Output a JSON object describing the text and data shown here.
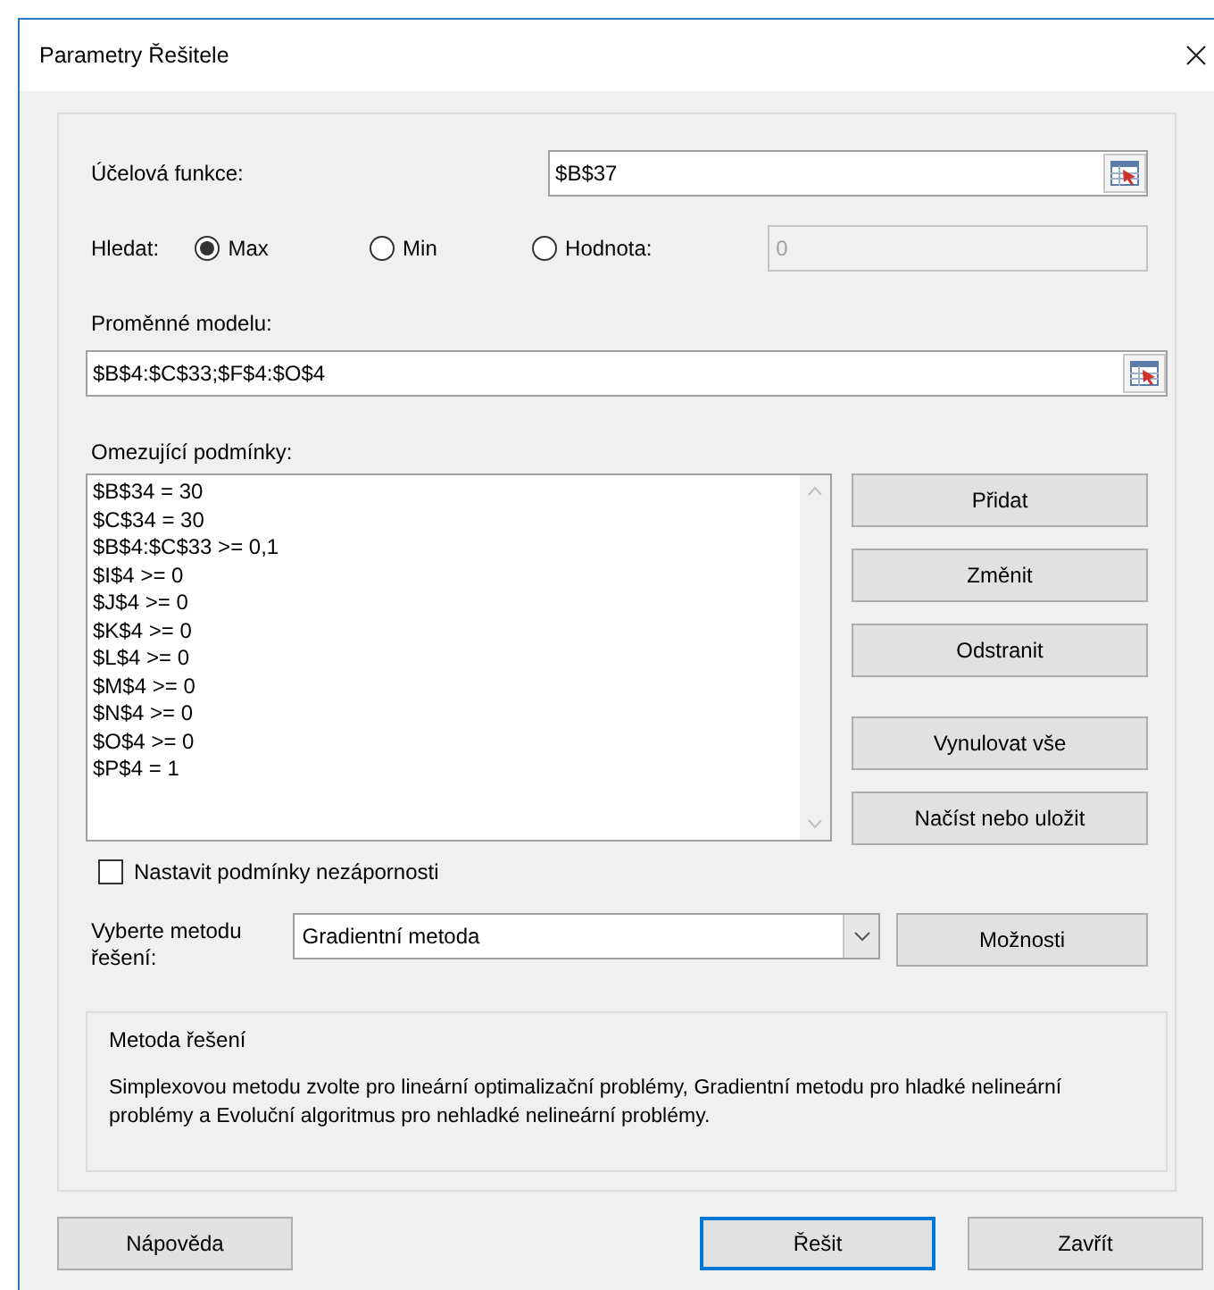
{
  "window": {
    "title": "Parametry Řešitele"
  },
  "objective": {
    "label": "Účelová funkce:",
    "value": "$B$37"
  },
  "goal": {
    "label": "Hledat:",
    "options": [
      {
        "label": "Max",
        "selected": true
      },
      {
        "label": "Min",
        "selected": false
      },
      {
        "label": "Hodnota:",
        "selected": false
      }
    ],
    "value_field": {
      "value": "0",
      "disabled": true
    }
  },
  "variables": {
    "label": "Proměnné modelu:",
    "value": "$B$4:$C$33;$F$4:$O$4"
  },
  "constraints": {
    "label": "Omezující podmínky:",
    "items": [
      "$B$34 = 30",
      "$C$34 = 30",
      "$B$4:$C$33 >= 0,1",
      "$I$4 >= 0",
      "$J$4 >= 0",
      "$K$4 >= 0",
      "$L$4 >= 0",
      "$M$4 >= 0",
      "$N$4 >= 0",
      "$O$4 >= 0",
      "$P$4 = 1"
    ],
    "buttons": [
      "Přidat",
      "Změnit",
      "Odstranit",
      "Vynulovat vše",
      "Načíst nebo uložit"
    ]
  },
  "nonnegative": {
    "label": "Nastavit podmínky nezápornosti",
    "checked": false
  },
  "method": {
    "label": "Vyberte metodu řešení:",
    "value": "Gradientní metoda",
    "options_button": "Možnosti"
  },
  "method_info": {
    "title": "Metoda řešení",
    "text": "Simplexovou metodu zvolte pro lineární optimalizační problémy, Gradientní metodu pro hladké nelineární problémy a Evoluční algoritmus pro nehladké nelineární problémy."
  },
  "footer_buttons": [
    {
      "label": "Nápověda",
      "default": false
    },
    {
      "label": "Řešit",
      "default": true
    },
    {
      "label": "Zavřít",
      "default": false
    }
  ]
}
